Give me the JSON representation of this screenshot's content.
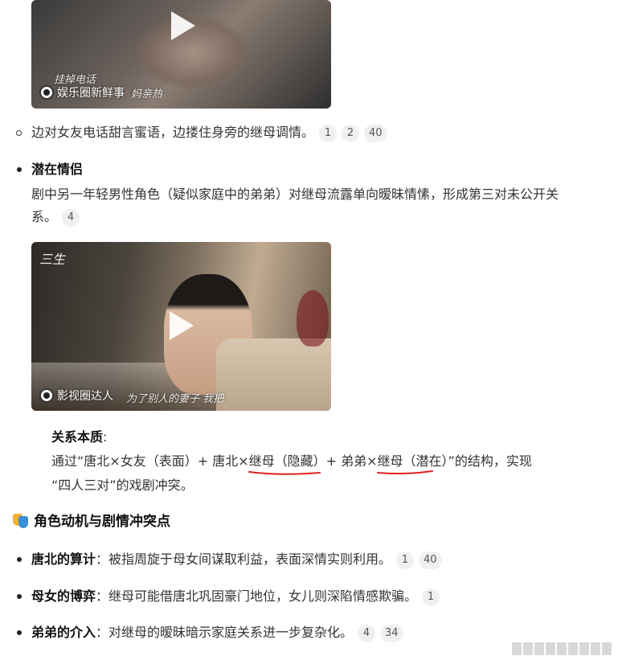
{
  "video1": {
    "channel": "娱乐圈新鲜事",
    "caption_line1": "挂掉电话",
    "caption_line2": "妈亲热"
  },
  "bullet1": {
    "text": "边对女友电话甜言蜜语，边搂住身旁的继母调情。",
    "refs": [
      "1",
      "2",
      "40"
    ]
  },
  "section_potential": {
    "title": "潜在情侣",
    "line1": "剧中另一年轻男性角色（疑似家庭中的弟弟）对继母流露单向暧昧情愫，形成第三对未公开关",
    "line2": "系。",
    "refs": [
      "4"
    ]
  },
  "video2": {
    "logo": "三生",
    "channel": "影视圈达人",
    "caption": "为了别人的妻子 我把"
  },
  "relation": {
    "label": "关系本质",
    "colon": ":",
    "line1_a": "通过“唐北×女友（表面）+ 唐北×",
    "line1_b": "继母（隐藏）",
    "line1_c": "+ 弟弟×",
    "line1_d": "继母（潜在）",
    "line1_e": "”的结构，实现",
    "line2": "“四人三对”的戏剧冲突。"
  },
  "heading": {
    "icon": "theater-masks-icon",
    "title": "角色动机与剧情冲突点"
  },
  "motives": [
    {
      "title": "唐北的算计",
      "text": "：被指周旋于母女间谋取利益，表面深情实则利用。",
      "refs": [
        "1",
        "40"
      ]
    },
    {
      "title": "母女的博弈",
      "text": "：继母可能借唐北巩固豪门地位，女儿则深陷情感欺骗。",
      "refs": [
        "1"
      ]
    },
    {
      "title": "弟弟的介入",
      "text": "：对继母的暧昧暗示家庭关系进一步复杂化。",
      "refs": [
        "4",
        "34"
      ]
    }
  ],
  "colors": {
    "underline": "#e02020",
    "badge_bg": "#f0f0f0"
  }
}
